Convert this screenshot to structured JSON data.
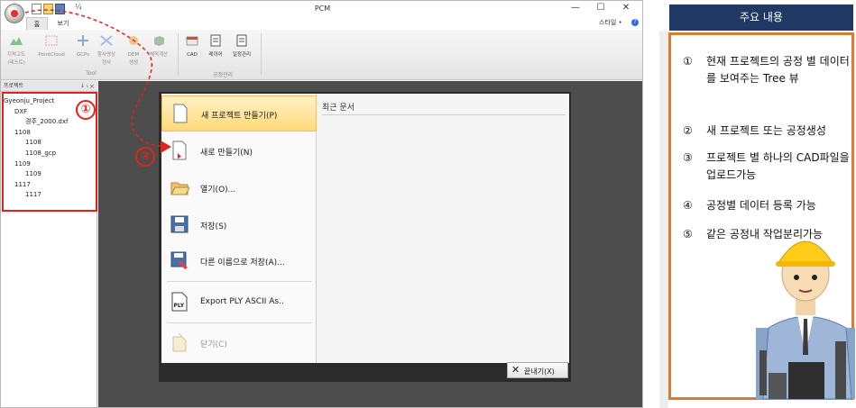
{
  "window": {
    "title": "PCM",
    "quick_access_more": "¼",
    "min": "—",
    "max": "☐",
    "close": "✕"
  },
  "tabs": {
    "home": "홈",
    "view": "보기"
  },
  "style_menu": "스타일 •",
  "help": "?",
  "ribbon": {
    "tool_items": [
      {
        "label1": "지적고도",
        "label2": "(테스트)",
        "icon": "terrain-icon",
        "color": "#3aa04a"
      },
      {
        "label1": "PointCloud",
        "label2": "",
        "icon": "pointcloud-icon",
        "color": "#d64040"
      },
      {
        "label1": "GCPs",
        "label2": "",
        "icon": "gcp-icon",
        "color": "#3a7cc9"
      },
      {
        "label1": "항사영상",
        "label2": "정사",
        "icon": "aerial-image-icon",
        "color": "#6a9fd8"
      },
      {
        "label1": "DEM",
        "label2": "생성",
        "icon": "dem-icon",
        "color": "#e8a030"
      },
      {
        "label1": "체적계산",
        "label2": "",
        "icon": "volume-icon",
        "color": "#5a8a5a"
      }
    ],
    "tool_group": "Tool",
    "process_items": [
      {
        "label": "CAD",
        "icon": "cad-icon"
      },
      {
        "label": "레이어",
        "icon": "layer-icon"
      },
      {
        "label": "일정관리",
        "icon": "schedule-icon"
      }
    ],
    "process_group": "공정관리"
  },
  "project_panel": {
    "title": "프로젝트",
    "pin": "↓ ⭏",
    "close": "×",
    "tree": [
      {
        "label": "Gyeonju_Project",
        "level": 0
      },
      {
        "label": "DXF",
        "level": 1
      },
      {
        "label": "경주_2000.dxf",
        "level": 2
      },
      {
        "label": "1108",
        "level": 1
      },
      {
        "label": "1108",
        "level": 2
      },
      {
        "label": "1108_gcp",
        "level": 2
      },
      {
        "label": "1109",
        "level": 1
      },
      {
        "label": "1109",
        "level": 2
      },
      {
        "label": "1117",
        "level": 1
      },
      {
        "label": "1117",
        "level": 2
      }
    ]
  },
  "backstage": {
    "menu": [
      {
        "label": "새 프로젝트 만들기(P)",
        "icon": "new-project-icon"
      },
      {
        "label": "새로 만들기(N)",
        "icon": "new-file-icon"
      },
      {
        "label": "열기(O)...",
        "icon": "open-folder-icon"
      },
      {
        "label": "저장(S)",
        "icon": "save-icon"
      },
      {
        "label": "다른 이름으로 저장(A)...",
        "icon": "save-as-icon"
      },
      {
        "label": "Export PLY ASCII As..",
        "icon": "ply-export-icon"
      },
      {
        "label": "닫기(C)",
        "icon": "close-file-icon"
      }
    ],
    "recent_title": "최근 문서",
    "exit_label": "끝내기(X)",
    "exit_icon": "✕"
  },
  "markers": {
    "m1": "①",
    "m2": "②"
  },
  "accent_color": "#e2231a",
  "info_panel": {
    "title": "주요 내용",
    "header_color": "#1f3864",
    "border_color": "#d97d2e",
    "items": [
      {
        "num": "①",
        "text": "현재 프로젝트의 공정 별 데이터를 보여주는 Tree 뷰"
      },
      {
        "num": "②",
        "text": "새 프로젝트 또는 공정생성"
      },
      {
        "num": "③",
        "text": "프로젝트 별 하나의 CAD파일을 업로드가능"
      },
      {
        "num": "④",
        "text": "공정별 데이터 등록 가능"
      },
      {
        "num": "⑤",
        "text": "같은 공정내 작업분리가능"
      }
    ]
  }
}
